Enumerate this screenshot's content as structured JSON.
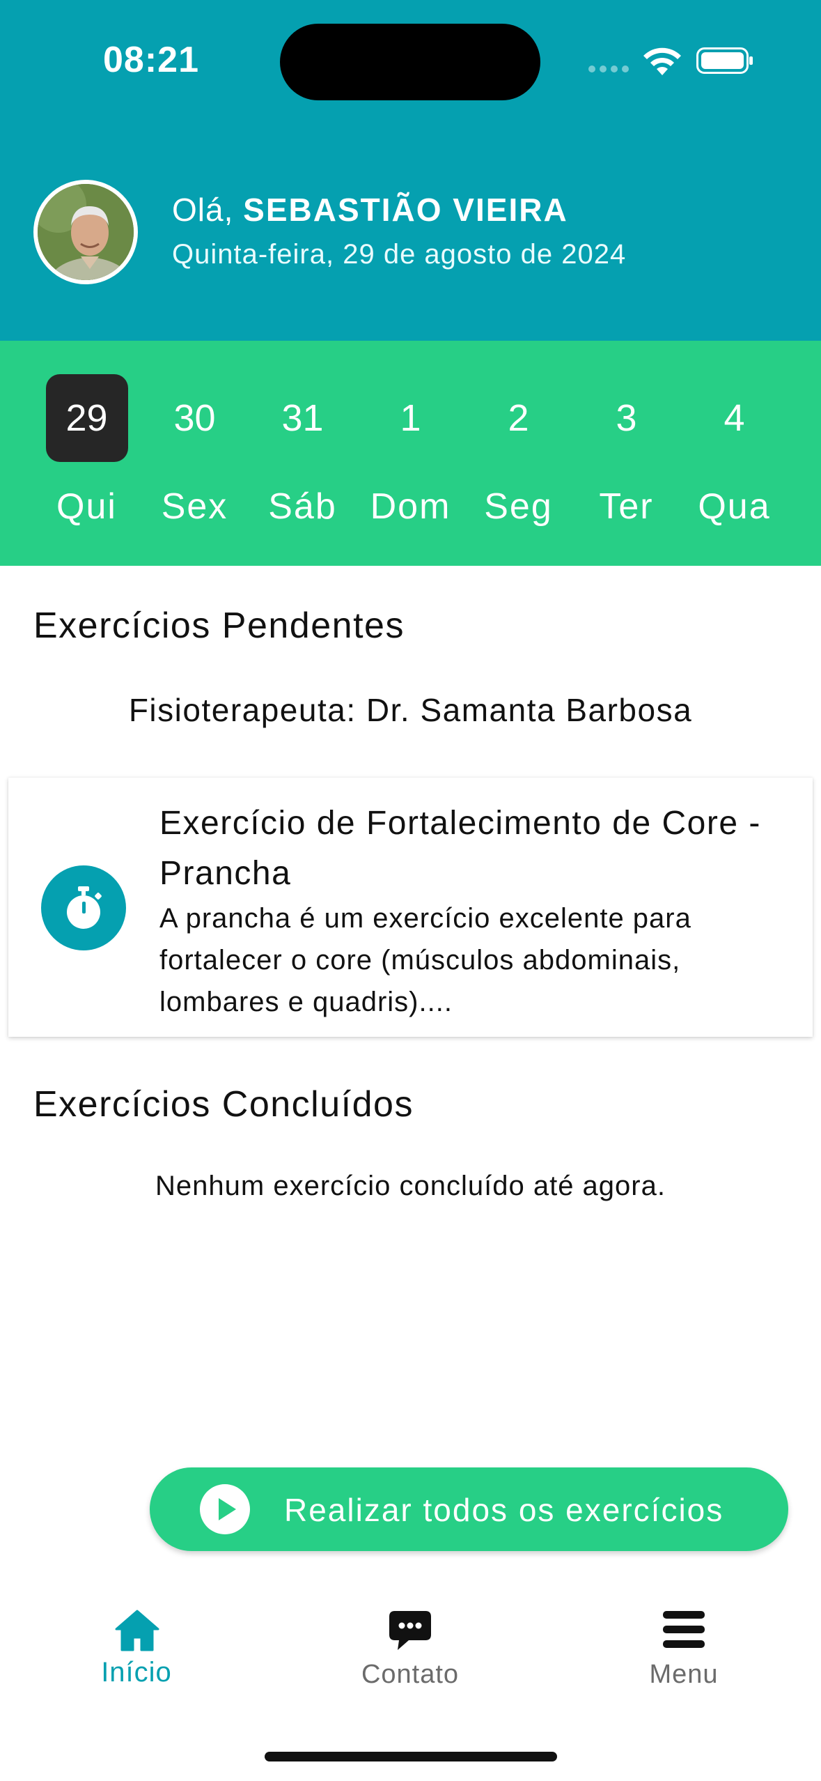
{
  "status_bar": {
    "time": "08:21"
  },
  "header": {
    "greeting_prefix": "Olá, ",
    "user_name": "SEBASTIÃO VIEIRA",
    "date": "Quinta-feira, 29 de agosto de 2024"
  },
  "week": {
    "selected_index": 0,
    "days": [
      {
        "num": "29",
        "name": "Qui"
      },
      {
        "num": "30",
        "name": "Sex"
      },
      {
        "num": "31",
        "name": "Sáb"
      },
      {
        "num": "1",
        "name": "Dom"
      },
      {
        "num": "2",
        "name": "Seg"
      },
      {
        "num": "3",
        "name": "Ter"
      },
      {
        "num": "4",
        "name": "Qua"
      }
    ]
  },
  "pending": {
    "title": "Exercícios Pendentes",
    "therapist": "Fisioterapeuta: Dr. Samanta Barbosa",
    "exercises": [
      {
        "title": "Exercício de Fortalecimento de Core - Prancha",
        "description": "A prancha é um exercício excelente para fortalecer o core (músculos abdominais, lombares e quadris)....",
        "icon": "stopwatch-icon"
      }
    ]
  },
  "completed": {
    "title": "Exercícios Concluídos",
    "empty_message": "Nenhum exercício concluído até agora."
  },
  "action": {
    "label": "Realizar todos os exercícios",
    "icon": "play-icon"
  },
  "tabbar": {
    "items": [
      {
        "label": "Início",
        "icon": "home-icon",
        "active": true
      },
      {
        "label": "Contato",
        "icon": "chat-icon",
        "active": false
      },
      {
        "label": "Menu",
        "icon": "menu-icon",
        "active": false
      }
    ]
  },
  "colors": {
    "header_bg": "#05a0b0",
    "accent_green": "#27cf86",
    "selected_day_bg": "#262626",
    "active_tab": "#05a0b0",
    "inactive_tab": "#6b6b6b"
  }
}
